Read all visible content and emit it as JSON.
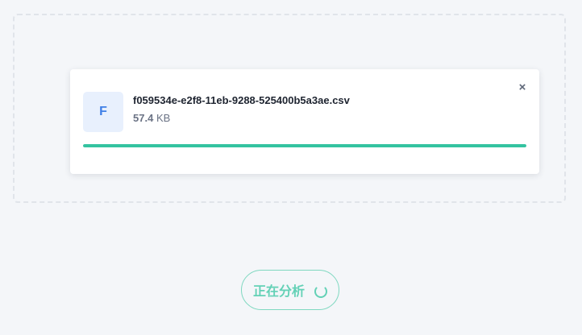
{
  "upload": {
    "file": {
      "icon_letter": "F",
      "name": "f059534e-e2f8-11eb-9288-525400b5a3ae.csv",
      "size_value": "57.4",
      "size_unit": "KB",
      "progress": 1.0
    },
    "close_glyph": "×"
  },
  "action": {
    "label": "正在分析",
    "state": "loading"
  },
  "colors": {
    "accent": "#34c3a0",
    "button_text": "#63d1b6",
    "file_icon_bg": "#e8f0fd",
    "file_icon_text": "#3f7fe6"
  },
  "icons": {
    "file": "file-icon",
    "close": "close-icon",
    "spinner": "loading-spinner-icon"
  }
}
